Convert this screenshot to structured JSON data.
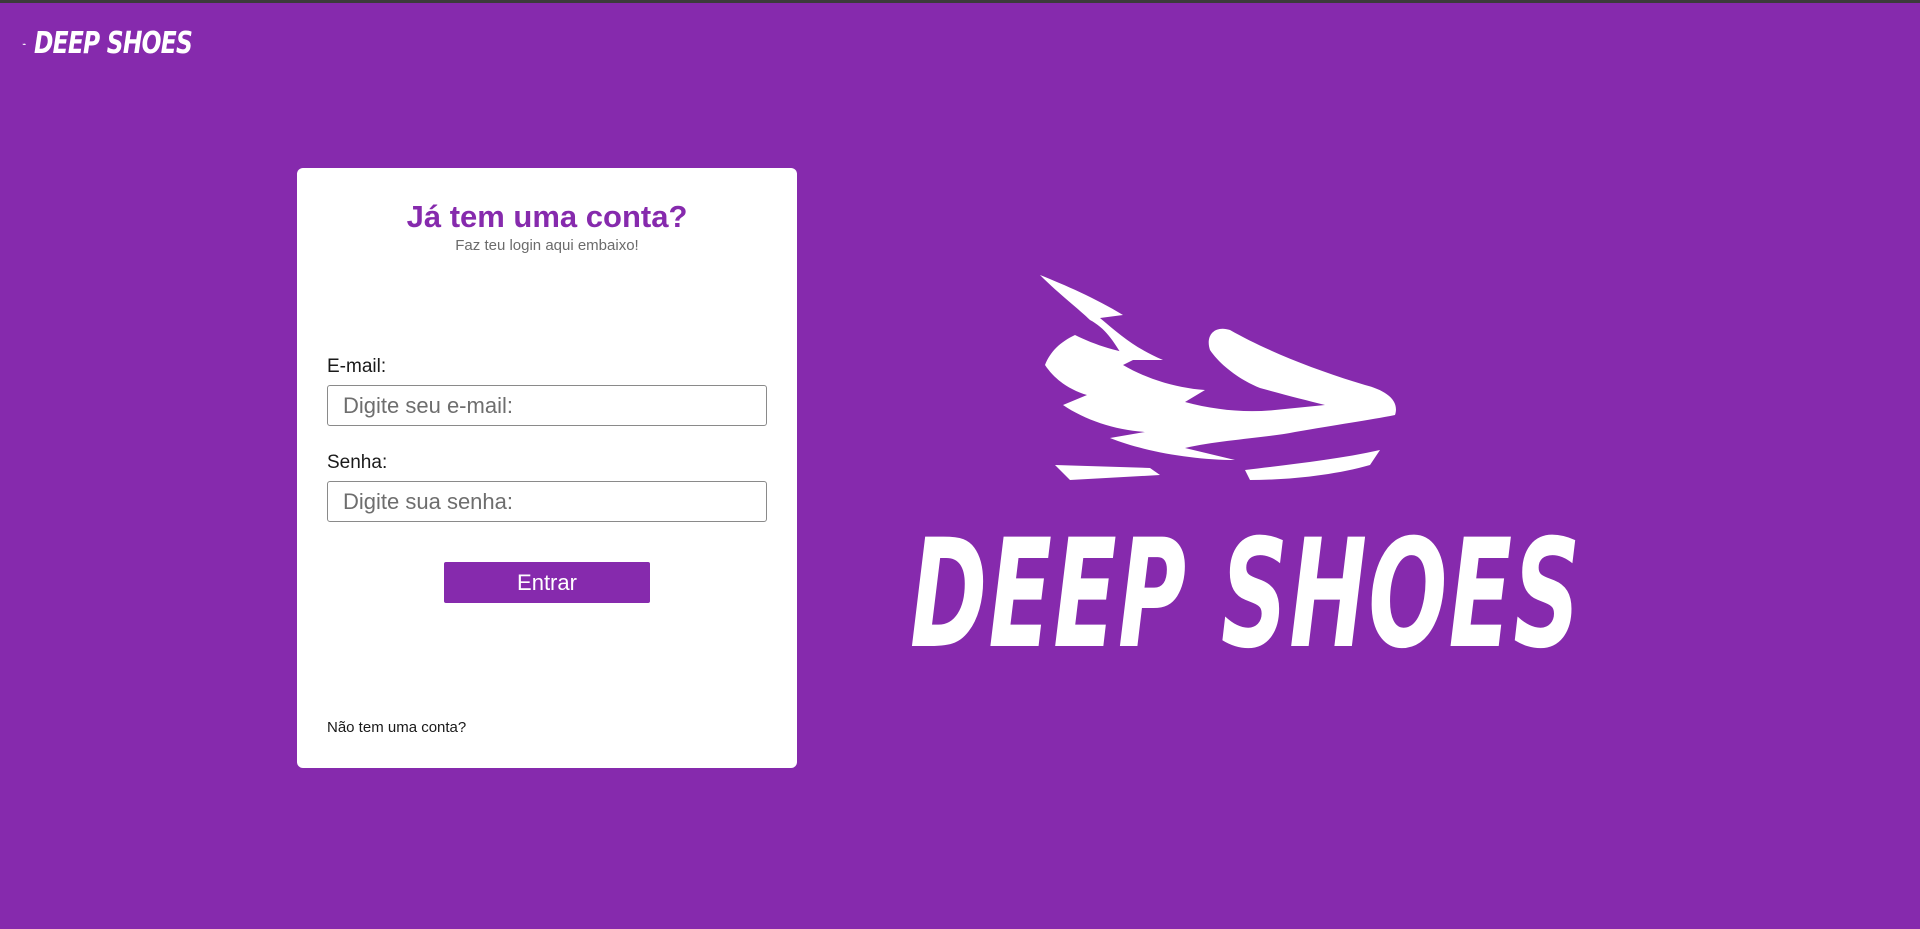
{
  "brand": {
    "name": "DEEP SHOES",
    "logo_icon": "winged-shoe-icon",
    "color": "#862aad"
  },
  "login": {
    "title": "Já tem uma conta?",
    "subtitle": "Faz teu login aqui embaixo!",
    "email_label": "E-mail:",
    "email_placeholder": "Digite seu e-mail:",
    "email_value": "",
    "password_label": "Senha:",
    "password_placeholder": "Digite sua senha:",
    "password_value": "",
    "submit_label": "Entrar",
    "signup_link": "Não tem uma conta?"
  },
  "colors": {
    "background": "#862aad",
    "card": "#ffffff",
    "accent": "#862aad"
  }
}
